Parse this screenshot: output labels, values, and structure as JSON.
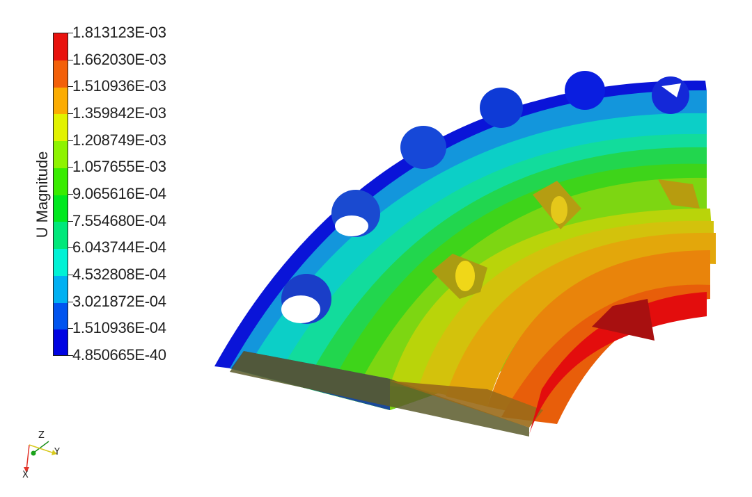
{
  "colorbar": {
    "title": "U Magnitude",
    "labels": [
      "1.813123E-03",
      "1.662030E-03",
      "1.510936E-03",
      "1.359842E-03",
      "1.208749E-03",
      "1.057655E-03",
      "9.065616E-04",
      "7.554680E-04",
      "6.043744E-04",
      "4.532808E-04",
      "3.021872E-04",
      "1.510936E-04",
      "4.850665E-40"
    ],
    "colors": [
      "#e8120e",
      "#f36009",
      "#fbac02",
      "#e2f200",
      "#8ef300",
      "#39ec00",
      "#00e81e",
      "#00e87a",
      "#00f2d5",
      "#00b0f2",
      "#0054ef",
      "#0003e2"
    ]
  },
  "triad": {
    "x_label": "X",
    "y_label": "Y",
    "z_label": "Z"
  }
}
